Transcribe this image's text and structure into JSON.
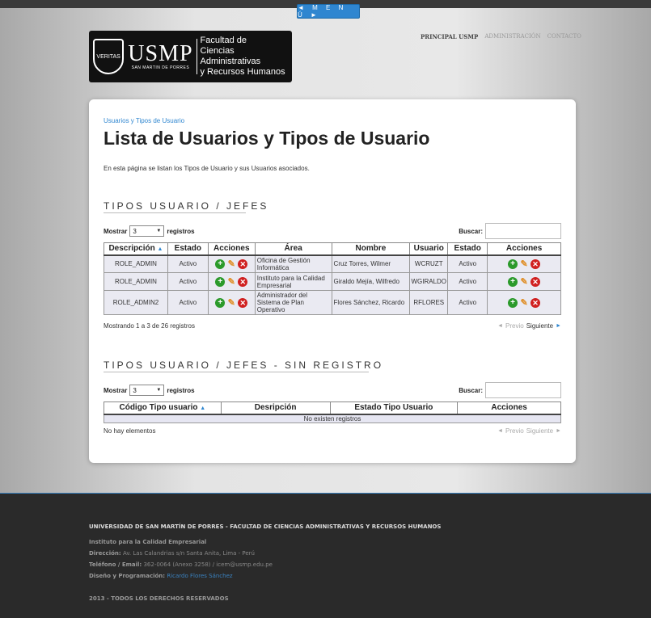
{
  "menu": {
    "label": "◄ M E N Ú ►"
  },
  "logo": {
    "seal_text": "VERITAS",
    "brand": "USMP",
    "brand_sub": "SAN MARTIN DE PORRES",
    "faculty_line1": "Facultad de",
    "faculty_line2": "Ciencias Administrativas",
    "faculty_line3": "y Recursos Humanos"
  },
  "topnav": {
    "items": [
      "PRINCIPAL USMP",
      "ADMINISTRACIÓN",
      "CONTACTO"
    ]
  },
  "page": {
    "breadcrumb": "Usuarios y Tipos de Usuario",
    "title": "Lista de Usuarios y Tipos de Usuario",
    "description": "En esta página se listan los Tipos de Usuario y sus Usuarios asociados."
  },
  "section1": {
    "heading": "TIPOS USUARIO / JEFES",
    "show_label": "Mostrar",
    "show_value": "3",
    "records_label": "registros",
    "search_label": "Buscar:",
    "columns": [
      "Descripción",
      "Estado",
      "Acciones",
      "Área",
      "Nombre",
      "Usuario",
      "Estado",
      "Acciones"
    ],
    "rows": [
      {
        "descripcion": "ROLE_ADMIN",
        "estado": "Activo",
        "area": "Oficina de Gestión Informática",
        "nombre": "Cruz Torres, Wilmer",
        "usuario": "WCRUZT",
        "estado2": "Activo"
      },
      {
        "descripcion": "ROLE_ADMIN",
        "estado": "Activo",
        "area": "Instituto para la Calidad Empresarial",
        "nombre": "Giraldo Mejía, Wilfredo",
        "usuario": "WGIRALDO",
        "estado2": "Activo"
      },
      {
        "descripcion": "ROLE_ADMIN2",
        "estado": "Activo",
        "area": "Administrador del Sistema de Plan Operativo",
        "nombre": "Flores Sánchez, Ricardo",
        "usuario": "RFLORES",
        "estado2": "Activo"
      }
    ],
    "info": "Mostrando 1 a 3 de 26 registros",
    "prev": "Previo",
    "next": "Siguiente"
  },
  "section2": {
    "heading": "TIPOS USUARIO / JEFES - SIN REGISTRO",
    "show_label": "Mostrar",
    "show_value": "3",
    "records_label": "registros",
    "search_label": "Buscar:",
    "columns": [
      "Código Tipo usuario",
      "Desripción",
      "Estado Tipo Usuario",
      "Acciones"
    ],
    "empty": "No existen registros",
    "info": "No hay elementos",
    "prev": "Previo",
    "next": "Siguiente"
  },
  "footer": {
    "title": "UNIVERSIDAD DE SAN MARTÍN DE PORRES - FACULTAD DE CIENCIAS ADMINISTRATIVAS Y RECURSOS HUMANOS",
    "institute": "Instituto para la Calidad Empresarial",
    "address_label": "Dirección:",
    "address": "Av. Las Calandrias s/n Santa Anita, Lima - Perú",
    "phone_label": "Teléfono / Email:",
    "phone": "362-0064 (Anexo 3258) / icem@usmp.edu.pe",
    "design_label": "Diseño y Programación:",
    "designer": "Ricardo Flores Sánchez",
    "copyright": "2013 - TODOS LOS DERECHOS RESERVADOS"
  },
  "colors": {
    "accent": "#2f86d0",
    "footer_bg": "#2a2a2a",
    "add": "#2b9a2b",
    "delete": "#d02020",
    "edit": "#e0902a"
  }
}
